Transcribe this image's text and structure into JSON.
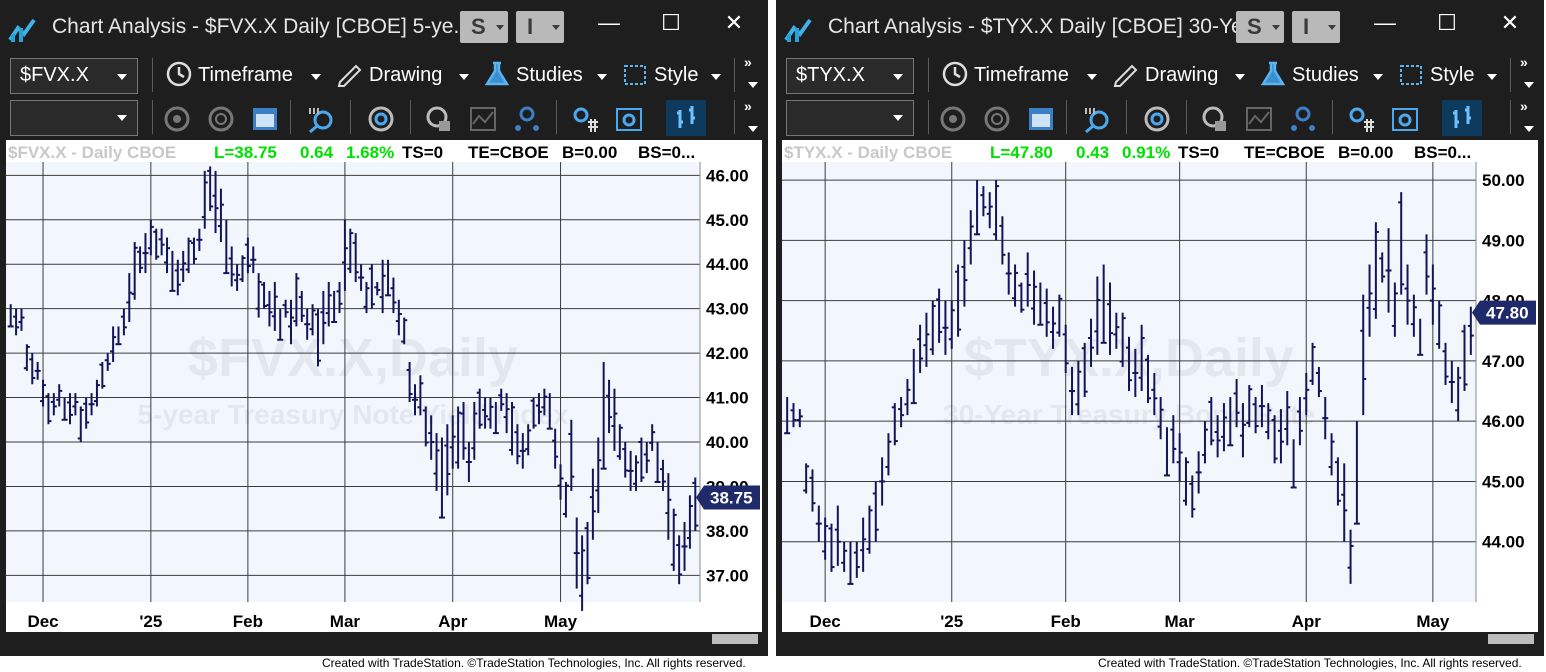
{
  "colors": {
    "frame": "#1e1e1e",
    "plot": "#f2f7fd",
    "bar": "#14145a",
    "grid": "#3c3c3c",
    "up": "#00e000",
    "badge": "#1f2a6b"
  },
  "footer": "Created with TradeStation. ©TradeStation Technologies, Inc. All rights reserved.",
  "panels": [
    {
      "title": "Chart Analysis - $FVX.X Daily [CBOE] 5-ye...",
      "s_label": "S",
      "i_label": "I",
      "win_controls": {
        "minimize": "—",
        "maximize": "☐",
        "close": "✕"
      },
      "toolbar": {
        "symbol": "$FVX.X",
        "timeframe": "Timeframe",
        "drawing": "Drawing",
        "studies": "Studies",
        "style": "Style",
        "more": "»"
      },
      "status": {
        "symbol": "$FVX.X - Daily  CBOE",
        "last": "L=38.75",
        "change": "0.64",
        "pct": "1.68%",
        "ts": "TS=0",
        "te": "TE=CBOE",
        "b": "B=0.00",
        "bs": "BS=0..."
      },
      "watermark": {
        "line1": "$FVX.X,Daily",
        "line2": "5-year Treasury Note Yield Index"
      },
      "axis": {
        "min": 36.4,
        "max": 46.3,
        "ticks": [
          "46.00",
          "45.00",
          "44.00",
          "43.00",
          "42.00",
          "41.00",
          "40.00",
          "39.00",
          "38.00",
          "37.00"
        ],
        "tick_values": [
          46,
          45,
          44,
          43,
          42,
          41,
          40,
          39,
          38,
          37
        ],
        "last_label": "38.75",
        "last_value": 38.75
      },
      "x_labels": [
        "Dec",
        "'25",
        "Feb",
        "Mar",
        "Apr",
        "May"
      ],
      "x_label_idx": [
        6,
        26,
        44,
        62,
        82,
        102
      ],
      "bars": [
        [
          42.6,
          43.1
        ],
        [
          42.4,
          43.0
        ],
        [
          42.5,
          43.0
        ],
        [
          41.6,
          42.2
        ],
        [
          41.3,
          42.0
        ],
        [
          41.4,
          41.8
        ],
        [
          40.8,
          41.4
        ],
        [
          40.4,
          41.1
        ],
        [
          40.6,
          41.1
        ],
        [
          40.8,
          41.3
        ],
        [
          40.5,
          41.0
        ],
        [
          40.4,
          41.1
        ],
        [
          40.6,
          41.1
        ],
        [
          40.0,
          40.8
        ],
        [
          40.3,
          41.0
        ],
        [
          40.6,
          41.1
        ],
        [
          40.8,
          41.4
        ],
        [
          41.2,
          41.8
        ],
        [
          41.6,
          42.0
        ],
        [
          41.8,
          42.6
        ],
        [
          42.2,
          42.6
        ],
        [
          42.4,
          43.0
        ],
        [
          42.7,
          43.8
        ],
        [
          43.2,
          44.5
        ],
        [
          43.8,
          44.4
        ],
        [
          43.8,
          44.7
        ],
        [
          44.2,
          45.0
        ],
        [
          44.1,
          44.8
        ],
        [
          44.2,
          44.8
        ],
        [
          43.8,
          44.6
        ],
        [
          43.4,
          44.3
        ],
        [
          43.3,
          44.1
        ],
        [
          43.6,
          44.3
        ],
        [
          43.8,
          44.6
        ],
        [
          44.0,
          44.6
        ],
        [
          44.3,
          44.8
        ],
        [
          44.8,
          46.1
        ],
        [
          45.2,
          46.2
        ],
        [
          44.7,
          46.1
        ],
        [
          44.5,
          45.7
        ],
        [
          43.8,
          45.0
        ],
        [
          43.5,
          44.4
        ],
        [
          43.4,
          44.0
        ],
        [
          43.6,
          44.2
        ],
        [
          43.8,
          44.6
        ],
        [
          43.8,
          44.4
        ],
        [
          42.8,
          43.8
        ],
        [
          43.0,
          43.6
        ],
        [
          42.6,
          43.4
        ],
        [
          42.5,
          43.6
        ],
        [
          42.3,
          43.0
        ],
        [
          42.8,
          43.2
        ],
        [
          42.2,
          43.2
        ],
        [
          42.6,
          43.8
        ],
        [
          42.7,
          43.4
        ],
        [
          42.3,
          43.0
        ],
        [
          42.4,
          43.1
        ],
        [
          41.7,
          43.0
        ],
        [
          42.2,
          43.4
        ],
        [
          42.6,
          43.6
        ],
        [
          42.7,
          43.4
        ],
        [
          42.9,
          43.6
        ],
        [
          43.4,
          45.0
        ],
        [
          43.8,
          44.8
        ],
        [
          43.6,
          44.7
        ],
        [
          43.4,
          44.0
        ],
        [
          42.9,
          43.6
        ],
        [
          43.0,
          44.0
        ],
        [
          43.3,
          43.6
        ],
        [
          42.9,
          44.1
        ],
        [
          43.3,
          44.1
        ],
        [
          42.9,
          43.7
        ],
        [
          42.4,
          43.2
        ],
        [
          42.2,
          42.8
        ],
        [
          40.9,
          41.8
        ],
        [
          40.6,
          41.3
        ],
        [
          40.6,
          41.5
        ],
        [
          39.9,
          40.8
        ],
        [
          39.6,
          40.6
        ],
        [
          38.9,
          40.2
        ],
        [
          38.3,
          40.1
        ],
        [
          38.8,
          40.4
        ],
        [
          39.4,
          40.6
        ],
        [
          39.4,
          40.8
        ],
        [
          39.6,
          40.9
        ],
        [
          39.1,
          40.0
        ],
        [
          39.6,
          40.9
        ],
        [
          40.3,
          41.2
        ],
        [
          40.3,
          41.0
        ],
        [
          40.3,
          41.0
        ],
        [
          40.2,
          40.9
        ],
        [
          40.7,
          41.2
        ],
        [
          40.2,
          41.1
        ],
        [
          39.7,
          40.9
        ],
        [
          39.5,
          40.4
        ],
        [
          39.4,
          40.2
        ],
        [
          39.7,
          40.4
        ],
        [
          40.3,
          41.0
        ],
        [
          40.4,
          41.1
        ],
        [
          40.6,
          41.2
        ],
        [
          40.3,
          41.1
        ]
      ],
      "bars2": [
        [
          39.4,
          40.3
        ],
        [
          38.7,
          39.5
        ],
        [
          38.3,
          39.1
        ],
        [
          38.9,
          40.5
        ],
        [
          36.7,
          38.3
        ],
        [
          36.2,
          37.9
        ],
        [
          36.8,
          38.2
        ],
        [
          37.8,
          39.4
        ],
        [
          38.4,
          40.1
        ],
        [
          39.4,
          41.8
        ],
        [
          40.2,
          41.4
        ],
        [
          39.8,
          41.2
        ],
        [
          39.6,
          40.4
        ],
        [
          39.2,
          40.0
        ],
        [
          38.9,
          39.8
        ],
        [
          38.9,
          39.7
        ],
        [
          39.1,
          40.1
        ],
        [
          39.3,
          40.0
        ],
        [
          39.8,
          40.4
        ],
        [
          39.1,
          40.0
        ],
        [
          38.9,
          39.6
        ],
        [
          37.8,
          39.3
        ],
        [
          37.1,
          38.5
        ],
        [
          36.8,
          37.9
        ],
        [
          37.1,
          38.2
        ],
        [
          37.6,
          38.8
        ],
        [
          38.0,
          39.2
        ]
      ]
    },
    {
      "title": "Chart Analysis - $TYX.X Daily [CBOE] 30-Ye...",
      "s_label": "S",
      "i_label": "I",
      "win_controls": {
        "minimize": "—",
        "maximize": "☐",
        "close": "✕"
      },
      "toolbar": {
        "symbol": "$TYX.X",
        "timeframe": "Timeframe",
        "drawing": "Drawing",
        "studies": "Studies",
        "style": "Style",
        "more": "»"
      },
      "status": {
        "symbol": "$TYX.X - Daily  CBOE",
        "last": "L=47.80",
        "change": "0.43",
        "pct": "0.91%",
        "ts": "TS=0",
        "te": "TE=CBOE",
        "b": "B=0.00",
        "bs": "BS=0..."
      },
      "watermark": {
        "line1": "$TYX.X,Daily",
        "line2": "30-Year Treasury Bond Rate"
      },
      "axis": {
        "min": 43.0,
        "max": 50.3,
        "ticks": [
          "50.00",
          "49.00",
          "48.00",
          "47.00",
          "46.00",
          "45.00",
          "44.00"
        ],
        "tick_values": [
          50,
          49,
          48,
          47,
          46,
          45,
          44
        ],
        "last_label": "47.80",
        "last_value": 47.8
      },
      "x_labels": [
        "Dec",
        "'25",
        "Feb",
        "Mar",
        "Apr",
        "May"
      ],
      "x_label_idx": [
        6,
        26,
        44,
        62,
        82,
        102
      ],
      "bars": [
        [
          45.8,
          46.4
        ],
        [
          45.9,
          46.3
        ],
        [
          45.9,
          46.2
        ],
        [
          44.8,
          45.3
        ],
        [
          44.5,
          45.2
        ],
        [
          44.0,
          44.6
        ],
        [
          43.7,
          44.4
        ],
        [
          43.5,
          44.3
        ],
        [
          43.6,
          44.6
        ],
        [
          43.5,
          44.0
        ],
        [
          43.3,
          44.0
        ],
        [
          43.4,
          44.0
        ],
        [
          43.5,
          44.4
        ],
        [
          43.8,
          44.6
        ],
        [
          44.0,
          45.0
        ],
        [
          44.6,
          45.4
        ],
        [
          45.1,
          45.8
        ],
        [
          45.6,
          46.3
        ],
        [
          45.9,
          46.4
        ],
        [
          46.1,
          46.7
        ],
        [
          46.3,
          47.2
        ],
        [
          46.8,
          47.6
        ],
        [
          46.9,
          47.8
        ],
        [
          47.1,
          48.0
        ],
        [
          47.3,
          48.2
        ],
        [
          47.1,
          48.0
        ],
        [
          47.2,
          48.0
        ],
        [
          47.4,
          48.6
        ],
        [
          47.9,
          49.0
        ],
        [
          48.6,
          49.5
        ],
        [
          49.1,
          50.0
        ],
        [
          49.4,
          49.9
        ],
        [
          49.2,
          49.8
        ],
        [
          49.0,
          50.0
        ],
        [
          48.6,
          49.4
        ],
        [
          48.1,
          48.8
        ],
        [
          47.9,
          48.6
        ],
        [
          47.8,
          48.3
        ],
        [
          47.9,
          48.8
        ],
        [
          47.6,
          48.5
        ],
        [
          47.6,
          48.3
        ],
        [
          47.4,
          48.2
        ],
        [
          47.2,
          47.9
        ],
        [
          47.4,
          48.1
        ],
        [
          46.8,
          47.6
        ],
        [
          46.1,
          46.9
        ],
        [
          46.1,
          47.0
        ],
        [
          46.4,
          47.3
        ],
        [
          46.9,
          47.7
        ],
        [
          47.1,
          48.4
        ],
        [
          47.3,
          48.6
        ],
        [
          47.1,
          48.3
        ],
        [
          47.2,
          47.8
        ],
        [
          46.9,
          47.8
        ],
        [
          46.5,
          47.4
        ],
        [
          46.4,
          47.2
        ],
        [
          46.5,
          47.6
        ],
        [
          46.3,
          47.1
        ],
        [
          46.1,
          46.8
        ],
        [
          45.7,
          46.4
        ]
      ],
      "bars2": [
        [
          45.1,
          45.9
        ],
        [
          45.3,
          46.1
        ],
        [
          45.0,
          45.8
        ],
        [
          44.6,
          45.4
        ],
        [
          44.4,
          45.1
        ],
        [
          44.8,
          45.5
        ],
        [
          45.3,
          46.0
        ],
        [
          45.6,
          46.4
        ],
        [
          45.4,
          46.1
        ],
        [
          45.5,
          46.3
        ],
        [
          45.6,
          46.4
        ],
        [
          45.9,
          46.7
        ],
        [
          45.4,
          46.3
        ],
        [
          45.9,
          46.6
        ],
        [
          45.8,
          46.4
        ],
        [
          45.9,
          46.6
        ],
        [
          45.7,
          46.3
        ],
        [
          45.3,
          46.1
        ],
        [
          45.3,
          46.2
        ],
        [
          45.6,
          46.5
        ],
        [
          44.9,
          45.7
        ],
        [
          45.6,
          46.4
        ],
        [
          46.1,
          46.8
        ],
        [
          46.6,
          47.3
        ],
        [
          46.4,
          46.9
        ],
        [
          45.7,
          46.4
        ],
        [
          45.1,
          45.8
        ],
        [
          44.6,
          45.4
        ],
        [
          44.0,
          45.3
        ],
        [
          43.3,
          44.2
        ],
        [
          44.3,
          46.0
        ],
        [
          46.1,
          48.1
        ],
        [
          47.4,
          48.6
        ],
        [
          47.7,
          49.3
        ],
        [
          48.3,
          48.8
        ],
        [
          47.8,
          49.2
        ],
        [
          47.4,
          48.3
        ],
        [
          48.1,
          49.8
        ],
        [
          47.6,
          48.6
        ],
        [
          47.4,
          48.1
        ],
        [
          47.1,
          47.7
        ],
        [
          48.1,
          49.1
        ],
        [
          47.6,
          48.6
        ],
        [
          47.2,
          48.0
        ],
        [
          46.6,
          47.3
        ],
        [
          46.3,
          47.0
        ],
        [
          46.0,
          46.9
        ],
        [
          46.5,
          47.6
        ],
        [
          47.1,
          47.9
        ]
      ]
    }
  ]
}
